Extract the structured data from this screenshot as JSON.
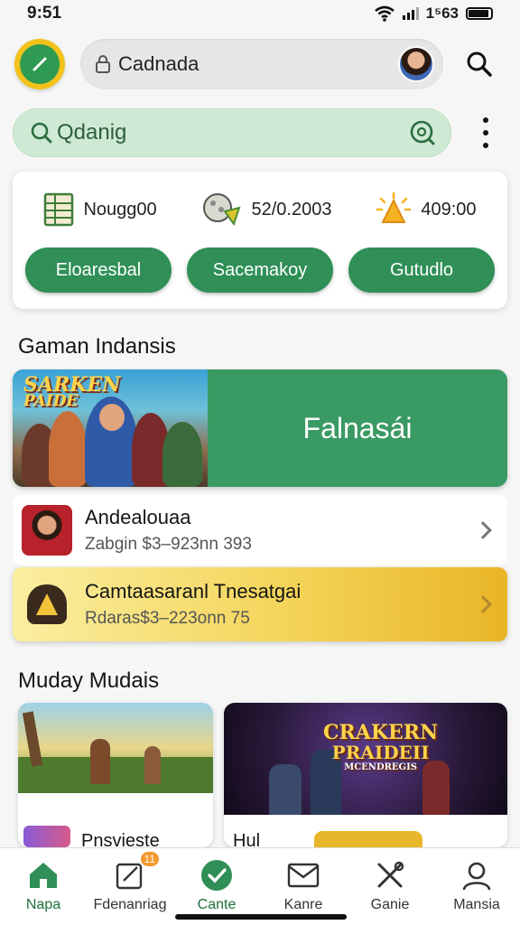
{
  "status": {
    "time": "9:51",
    "signal_text": "1⁵63"
  },
  "header": {
    "address_text": "Cadnada"
  },
  "search": {
    "value": "Qdanig"
  },
  "stats": [
    {
      "icon": "spreadsheet-icon",
      "value": "Nougg00"
    },
    {
      "icon": "ball-icon",
      "value": "52/0.2003"
    },
    {
      "icon": "bell-icon",
      "value": "409:00"
    }
  ],
  "actions": [
    "Eloaresbal",
    "Sacemakoy",
    "Gutudlo"
  ],
  "section1": {
    "title": "Gaman Indansis"
  },
  "feature": {
    "art_title_line1": "SARKEN",
    "art_title_line2": "PAIDE",
    "label": "Falnasái"
  },
  "rows": [
    {
      "title": "Andealouaa",
      "subtitle": "Zabgin $3–923nn 393"
    },
    {
      "title": "Camtaasaranl Tnesatgai",
      "subtitle": "Rdaras$3–223onn 75"
    }
  ],
  "section2": {
    "title": "Muday Mudais"
  },
  "tiles": [
    {
      "label": "Pnsvieste"
    },
    {
      "label": "Hul",
      "art_title_line1": "CRAKERN",
      "art_title_line2": "PRAIDEII",
      "art_subtitle": "MCENDREGIS"
    }
  ],
  "tabs": [
    {
      "label": "Napa",
      "icon": "home-icon",
      "active": true
    },
    {
      "label": "Fdenanriag",
      "icon": "edit-icon",
      "badge": "11"
    },
    {
      "label": "Cante",
      "icon": "check-icon",
      "active": true
    },
    {
      "label": "Kanre",
      "icon": "mail-icon"
    },
    {
      "label": "Ganie",
      "icon": "tools-icon"
    },
    {
      "label": "Mansia",
      "icon": "profile-icon"
    }
  ],
  "colors": {
    "accent": "#2f8f56",
    "yellow": "#f2c21b"
  }
}
